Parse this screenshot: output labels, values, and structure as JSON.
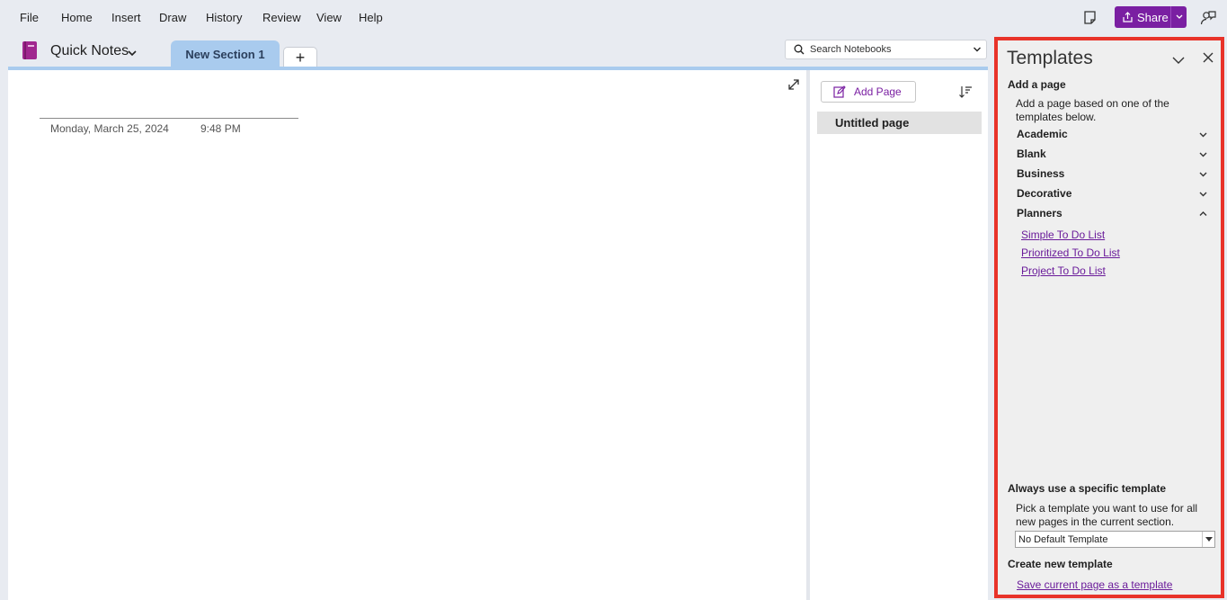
{
  "menu": {
    "items": [
      "File",
      "Home",
      "Insert",
      "Draw",
      "History",
      "Review",
      "View",
      "Help"
    ]
  },
  "toolbar": {
    "share_label": "Share"
  },
  "notebook": {
    "name": "Quick Notes",
    "section_tab": "New Section 1",
    "add_tab_label": "+"
  },
  "search": {
    "placeholder": "Search Notebooks"
  },
  "page": {
    "date": "Monday, March 25, 2024",
    "time": "9:48 PM"
  },
  "pages_pane": {
    "add_page_label": "Add Page",
    "pages": [
      "Untitled page"
    ]
  },
  "templates": {
    "title": "Templates",
    "add_page_heading": "Add a page",
    "add_page_desc_line1": "Add a page based on one of the",
    "add_page_desc_line2": "templates below.",
    "categories": [
      {
        "label": "Academic",
        "expanded": false
      },
      {
        "label": "Blank",
        "expanded": false
      },
      {
        "label": "Business",
        "expanded": false
      },
      {
        "label": "Decorative",
        "expanded": false
      },
      {
        "label": "Planners",
        "expanded": true
      }
    ],
    "planner_links": [
      "Simple To Do List",
      "Prioritized To Do List",
      "Project To Do List"
    ],
    "always_heading": "Always use a specific template",
    "always_desc_line1": "Pick a template you want to use for all",
    "always_desc_line2": "new pages in the current section.",
    "default_template_value": "No Default Template",
    "create_heading": "Create new template",
    "save_link": "Save current page as a template"
  },
  "colors": {
    "accent": "#7a1fa2",
    "highlight_border": "#e8332a",
    "section_tab": "#a9cbee"
  }
}
